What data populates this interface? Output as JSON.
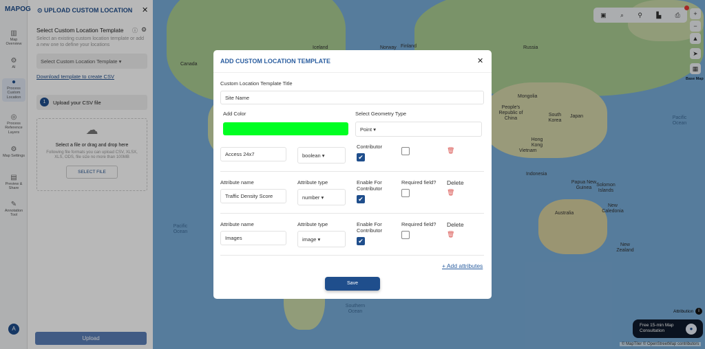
{
  "app": {
    "logo": "MAPOG",
    "panel_title": "UPLOAD CUSTOM LOCATION"
  },
  "rail": [
    {
      "label": "Map Overview",
      "icon": "map-icon"
    },
    {
      "label": "AI",
      "icon": "ai-icon"
    },
    {
      "label": "Process Custom Location",
      "icon": "pin-icon",
      "active": true
    },
    {
      "label": "Process Reference Layers",
      "icon": "layers-icon"
    },
    {
      "label": "Map Settings",
      "icon": "gear-icon"
    },
    {
      "label": "Preview & Share",
      "icon": "share-icon"
    },
    {
      "label": "Annotation Tool",
      "icon": "annotation-icon"
    }
  ],
  "user_avatar": "A",
  "panel": {
    "section_title": "Select Custom Location Template",
    "section_desc": "Select an existing custom location template or add a new one to define your locations",
    "template_select": "Select Custom Location Template",
    "download_link": "Download template to create CSV",
    "step_number": "1",
    "step_label": "Upload your CSV file",
    "drop_title": "Select a file or drag and drop here",
    "drop_desc": "Following file formats you can upload CSV, XLSX, XLS, ODS, file size no more than 100MB",
    "select_file": "SELECT FILE",
    "upload": "Upload"
  },
  "modal": {
    "title": "ADD CUSTOM LOCATION TEMPLATE",
    "title_label": "Custom Location Template Title",
    "title_value": "Site Name",
    "color_label": "Add Color",
    "color_value": "#00ff22",
    "geometry_label": "Select Geometry Type",
    "geometry_value": "Point",
    "col_name": "Attribute name",
    "col_type": "Attribute type",
    "col_enable": "Enable For Contributor",
    "col_enable_cut": "Contributor",
    "col_required": "Required field?",
    "col_delete": "Delete",
    "attributes": [
      {
        "name": "Access 24x7",
        "type": "boolean",
        "enabled": true,
        "required": false
      },
      {
        "name": "Traffic Density Score",
        "type": "number",
        "enabled": true,
        "required": false
      },
      {
        "name": "Images",
        "type": "image",
        "enabled": true,
        "required": false
      }
    ],
    "add_attributes": "+ Add attributes",
    "save": "Save"
  },
  "map": {
    "labels": [
      "Iceland",
      "Norway",
      "Finland",
      "Russia",
      "Canada",
      "Mongolia",
      "People's Republic of China",
      "South Korea",
      "Japan",
      "Hong Kong",
      "Vietnam",
      "Indonesia",
      "Papua New Guinea",
      "Solomon Islands",
      "New Caledonia",
      "Australia",
      "New Zealand",
      "Pacific Ocean",
      "Pacific Ocean",
      "Southern Ocean"
    ],
    "base_map": "Base Map",
    "attribution": "Attribution",
    "consult": "Free 15-min Map Consultation",
    "copyright": "© MapTiler © OpenStreetMap contributors"
  },
  "colors": {
    "accent": "#1f4e8c",
    "save": "#1f4e8c"
  }
}
